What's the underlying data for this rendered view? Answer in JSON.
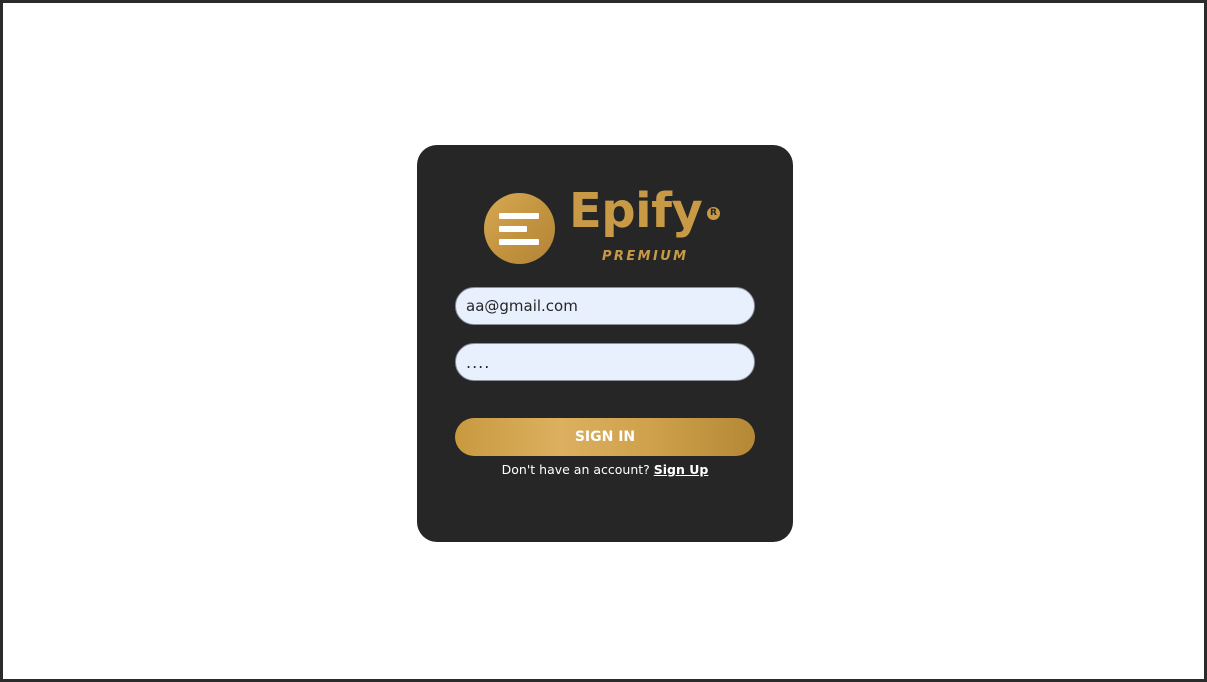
{
  "brand": {
    "name": "Epify",
    "registered_mark": "R",
    "tagline": "PREMIUM",
    "logo_icon": "menu-lines-icon",
    "color": "#c99a46"
  },
  "form": {
    "email_value": "aa@gmail.com",
    "password_value": "....",
    "signin_label": "SIGN IN",
    "signup_prompt": "Don't have an account?",
    "signup_link": "Sign Up"
  },
  "colors": {
    "card_background": "#262626",
    "input_background": "#e8f0fe",
    "button_gold": "#d4a856"
  }
}
